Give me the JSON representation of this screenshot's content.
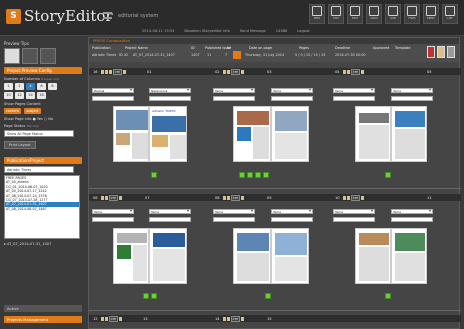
{
  "header": {
    "logo_letter": "S",
    "app_name": "StoryEditor",
    "app_subtitle": "editorial system",
    "status": [
      "2014-06-11 13:53",
      "Dbadmin Storyeditor info",
      "Send Message",
      "14386",
      "Logout"
    ],
    "tool_buttons": [
      "INFO",
      "STAT",
      "EDIT",
      "ARCH",
      "PUB",
      "FILES",
      "PRINT",
      "LIST"
    ]
  },
  "sidebar": {
    "preview_tips": "Preview Tips",
    "section_catalog": "Project Preview Config",
    "columns_label": "Number of Columns",
    "columns_hint": "if equal only",
    "columns_row1": [
      "1",
      "2",
      "4",
      "6",
      "8"
    ],
    "columns_row2": [
      "10",
      "12",
      "14",
      "16"
    ],
    "columns_selected": "4",
    "show_content_label": "Show Pages Content",
    "content_chip": "content",
    "subject_chip": "subject",
    "show_page_info_label": "Show Page info",
    "yes_label": "Yes",
    "no_label": "No",
    "page_status_label": "Page Status",
    "page_status_hint": "Tab only",
    "page_status_value": "Show All Page Status",
    "print_layout": "Print Layout",
    "section_publication": "Publication/Project",
    "publication_value": "Adriatic Times",
    "project_list": [
      "FREE-PAGES",
      "AT_05_athens",
      "CG_01_2014-06-07_1020",
      "AT_05_2014-07-17_1242",
      "AT_06_2014-07-24_1376",
      "CG_07_2014-07-28_1277",
      "AT_07_2014-07-31_1407",
      "AT_08_2014-08-07_1467"
    ],
    "project_selected_index": 6,
    "active_project": "AT_07_2014-07-31_1407",
    "archive_tab": "Active",
    "management_tab": "Projects Management"
  },
  "main": {
    "section_title": "PRESS Composition",
    "info_headers": [
      "Publication",
      "Project Name",
      "ID",
      "Published Issue",
      "Nr",
      "Date on page",
      "Pages",
      "Deadline",
      "Approved",
      "Template"
    ],
    "info_values": [
      "Adriatic Times",
      "ID 42",
      "AT_07_2014-07-31_1407",
      "1407",
      "11",
      "7",
      "Thursday, 31 July 2014",
      "5 / 0 / 10 / 15 / 15",
      "2014-07-30 00:00",
      "",
      ""
    ],
    "page_numbers_row1": [
      "16",
      "01",
      "02",
      "03",
      "04",
      "05"
    ],
    "page_numbers_row2": [
      "06",
      "07",
      "08",
      "09",
      "10",
      "11"
    ],
    "page_numbers_row3": [
      "12",
      "13",
      "14",
      "15"
    ],
    "ctp_label": "CTP",
    "select_values_row1": [
      "Zadnja",
      "Naslovnica",
      "Tema",
      "Tema",
      "Tema",
      "Tema"
    ],
    "select_values_row2": [
      "Tema",
      "Tema",
      "Tema",
      "Tema",
      "Tema",
      "Tema"
    ],
    "masthead": "Adriatic TIMES"
  }
}
